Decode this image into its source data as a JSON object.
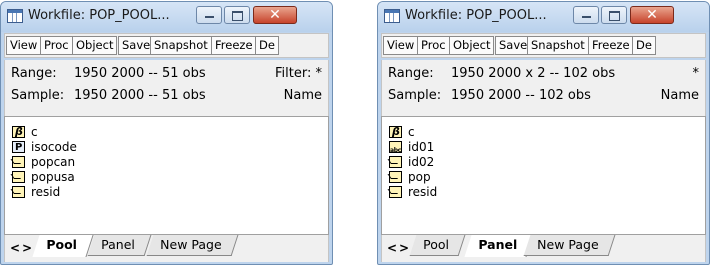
{
  "windows": [
    {
      "title": "Workfile: POP_POOL...",
      "toolbar": [
        "View",
        "Proc",
        "Object",
        "Save",
        "Snapshot",
        "Freeze",
        "De"
      ],
      "range_label": "Range:",
      "range_value": "1950 2000   --   51 obs",
      "filter_text": "Filter: *",
      "sample_label": "Sample:",
      "sample_value": "1950 2000   --   51 obs",
      "order_text": "Name",
      "items": [
        {
          "icon": "coef-beta-icon",
          "name": "c"
        },
        {
          "icon": "pool-icon",
          "name": "isocode"
        },
        {
          "icon": "series-icon",
          "name": "popcan"
        },
        {
          "icon": "series-icon",
          "name": "popusa"
        },
        {
          "icon": "series-icon",
          "name": "resid"
        }
      ],
      "nav": "<>",
      "tabs": [
        "Pool",
        "Panel",
        "New Page"
      ],
      "active_tab": "Pool"
    },
    {
      "title": "Workfile: POP_POOL...",
      "toolbar": [
        "View",
        "Proc",
        "Object",
        "Save",
        "Snapshot",
        "Freeze",
        "De"
      ],
      "range_label": "Range:",
      "range_value": "1950 2000 x 2  --  102 obs",
      "filter_text": "*",
      "sample_label": "Sample:",
      "sample_value": "1950 2000   --   102 obs",
      "order_text": "Name",
      "items": [
        {
          "icon": "coef-beta-icon",
          "name": "c"
        },
        {
          "icon": "alpha-series-icon",
          "name": "id01"
        },
        {
          "icon": "series-icon",
          "name": "id02"
        },
        {
          "icon": "series-icon",
          "name": "pop"
        },
        {
          "icon": "series-icon",
          "name": "resid"
        }
      ],
      "nav": "<>",
      "tabs": [
        "Pool",
        "Panel",
        "New Page"
      ],
      "active_tab": "Panel"
    }
  ],
  "colors": {
    "title_bg": "#c4d8ef",
    "close_button": "#c7432b",
    "series_icon_fill": "#fff4b8"
  }
}
